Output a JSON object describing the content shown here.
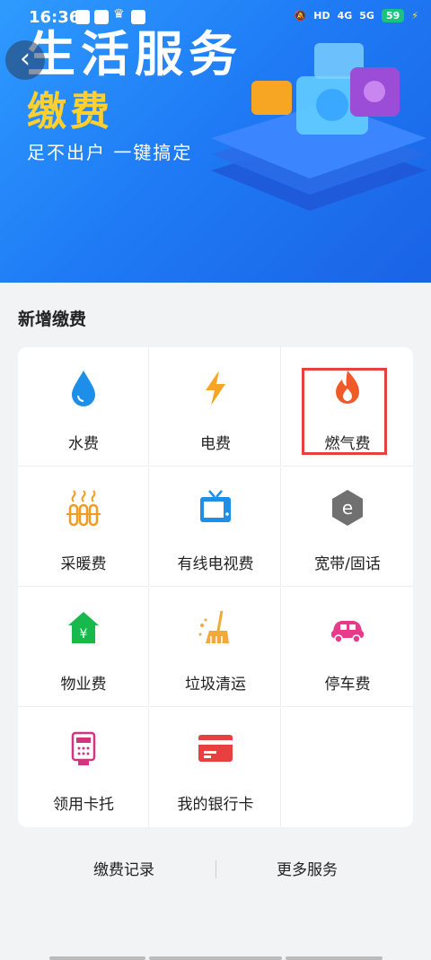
{
  "status_bar": {
    "time": "16:36",
    "signal1": "4G",
    "signal2": "5G",
    "battery": "59"
  },
  "banner": {
    "title": "生活服务",
    "subtitle": "缴费",
    "slogan": "足不出户 一键搞定"
  },
  "section": {
    "title": "新增缴费"
  },
  "services": [
    {
      "label": "水费",
      "icon": "water-drop-icon",
      "color": "#1e8fe8"
    },
    {
      "label": "电费",
      "icon": "lightning-icon",
      "color": "#f6a623"
    },
    {
      "label": "燃气费",
      "icon": "flame-icon",
      "color": "#f05a28"
    },
    {
      "label": "采暖费",
      "icon": "radiator-icon",
      "color": "#f39b1e"
    },
    {
      "label": "有线电视费",
      "icon": "tv-icon",
      "color": "#1e8fe8"
    },
    {
      "label": "宽带/固话",
      "icon": "broadband-icon",
      "color": "#707070"
    },
    {
      "label": "物业费",
      "icon": "property-house-icon",
      "color": "#18b94c"
    },
    {
      "label": "垃圾清运",
      "icon": "broom-icon",
      "color": "#f2a93b"
    },
    {
      "label": "停车费",
      "icon": "car-icon",
      "color": "#e63b8a"
    },
    {
      "label": "领用卡托",
      "icon": "card-reader-icon",
      "color": "#d2357f"
    },
    {
      "label": "我的银行卡",
      "icon": "bank-card-icon",
      "color": "#e8403e"
    }
  ],
  "footer": {
    "records": "缴费记录",
    "more": "更多服务"
  }
}
